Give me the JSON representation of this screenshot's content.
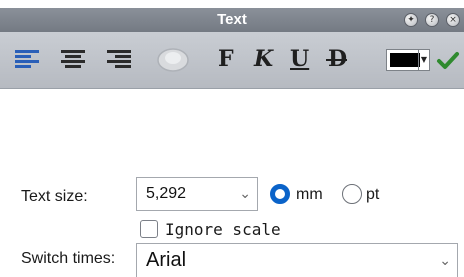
{
  "window": {
    "title": "Text"
  },
  "titlebar_buttons": [
    {
      "icon": "pin-icon",
      "glyph": "✦"
    },
    {
      "icon": "help-icon",
      "glyph": "?"
    },
    {
      "icon": "close-icon",
      "glyph": "×"
    }
  ],
  "toolbar": {
    "align_left_icon": "align-left-icon",
    "align_center_icon": "align-center-icon",
    "align_right_icon": "align-right-icon",
    "font_icon": "font-icon",
    "bold": "F",
    "italic": "K",
    "underline": "U",
    "strikethrough": "D",
    "color": "#000000"
  },
  "text_size": {
    "label": "Text size:",
    "value": "5,292",
    "unit_mm": "mm",
    "unit_pt": "pt",
    "selected_unit": "mm"
  },
  "ignore_scale": {
    "label": "Ignore scale",
    "checked": false
  },
  "switch_times": {
    "label": "Switch times:",
    "value": "Arial"
  },
  "colors": {
    "accent": "#0a63c9"
  }
}
